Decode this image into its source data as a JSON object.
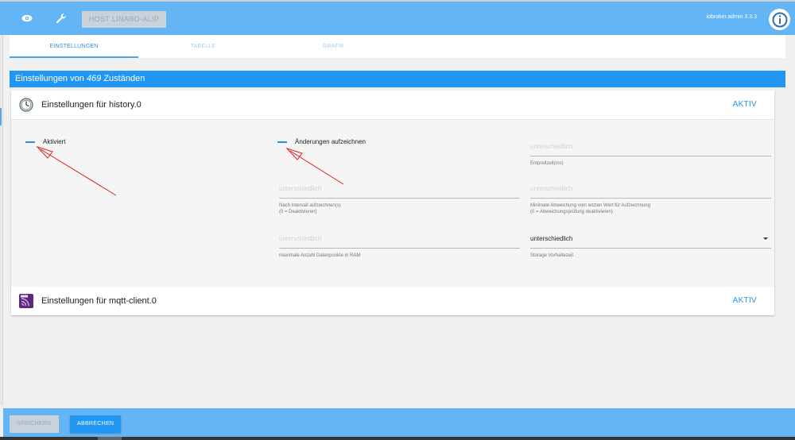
{
  "topbar": {
    "host_button": "HOST LINARO-ALIP",
    "version": "iobroker.admin 3.3.3",
    "icons": [
      "eye-icon",
      "wrench-icon",
      "info-icon"
    ]
  },
  "tabs": [
    {
      "label": "EINSTELLUNGEN",
      "active": true
    },
    {
      "label": "TABELLE",
      "active": false
    },
    {
      "label": "GRAFIK",
      "active": false
    }
  ],
  "settings_header": {
    "prefix": "Einstellungen von",
    "count": "469",
    "suffix": "Zuständen"
  },
  "instances": [
    {
      "title": "Einstellungen für history.0",
      "state": "AKTIV",
      "icon": "clock-icon"
    },
    {
      "title": "Einstellungen für mqtt-client.0",
      "state": "AKTIV",
      "icon": "mqtt-icon"
    }
  ],
  "history_settings": {
    "enabled_label": "Aktiviert",
    "changes_only_label": "Änderungen aufzeichnen",
    "debounce": {
      "value": "unterschiedlich",
      "help": "Entprellzeit(ms)"
    },
    "interval": {
      "value": "unterschiedlich",
      "help": "Nach Intervall aufzeichnen(s)",
      "help2": "(0 = Deaktivieren)"
    },
    "min_deviation": {
      "value": "unterschiedlich",
      "help": "Minimale Abweichung vom letzten Wert für Aufzeichnung",
      "help2": "(0 = Abweichungsprüfung deaktivieren)"
    },
    "max_points": {
      "value": "unterschiedlich",
      "help": "maximale Anzahl Datenpunkte in RAM"
    },
    "retention": {
      "value": "unterschiedlich",
      "help": "Storage Vorhaltezeit"
    }
  },
  "footer": {
    "save_label": "SPEICHERN",
    "cancel_label": "ABBRECHEN"
  },
  "colors": {
    "header_bar": "#64b5f6",
    "accent": "#2196f3",
    "annotation_arrow": "#d9201c"
  }
}
